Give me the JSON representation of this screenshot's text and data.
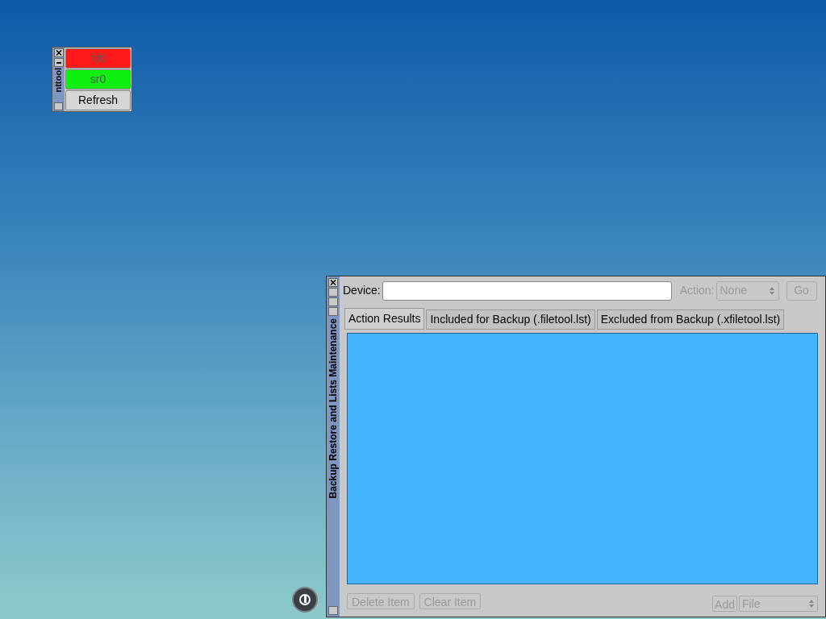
{
  "drive_window": {
    "title": "nttool",
    "buttons": [
      {
        "label": "fd0",
        "color": "#ff1a1a"
      },
      {
        "label": "sr0",
        "color": "#10f010"
      },
      {
        "label": "Refresh"
      }
    ]
  },
  "backup_window": {
    "title": "Backup Restore and Lists Maintenance",
    "device_label": "Device:",
    "action_label": "Action:",
    "action": {
      "value": "None",
      "disabled": true
    },
    "go": {
      "label": "Go",
      "disabled": true
    },
    "tabs": [
      {
        "label": "Action Results",
        "selected": true
      },
      {
        "label": "Included for Backup (.filetool.lst)",
        "selected": false
      },
      {
        "label": "Excluded from Backup (.xfiletool.lst)",
        "selected": false
      }
    ],
    "buttons": [
      {
        "label": "Delete Item",
        "disabled": true
      },
      {
        "label": "Clear Item",
        "disabled": true
      }
    ],
    "add": {
      "label": "Add",
      "disabled": true
    },
    "add_type": {
      "value": "File",
      "disabled": true
    }
  }
}
